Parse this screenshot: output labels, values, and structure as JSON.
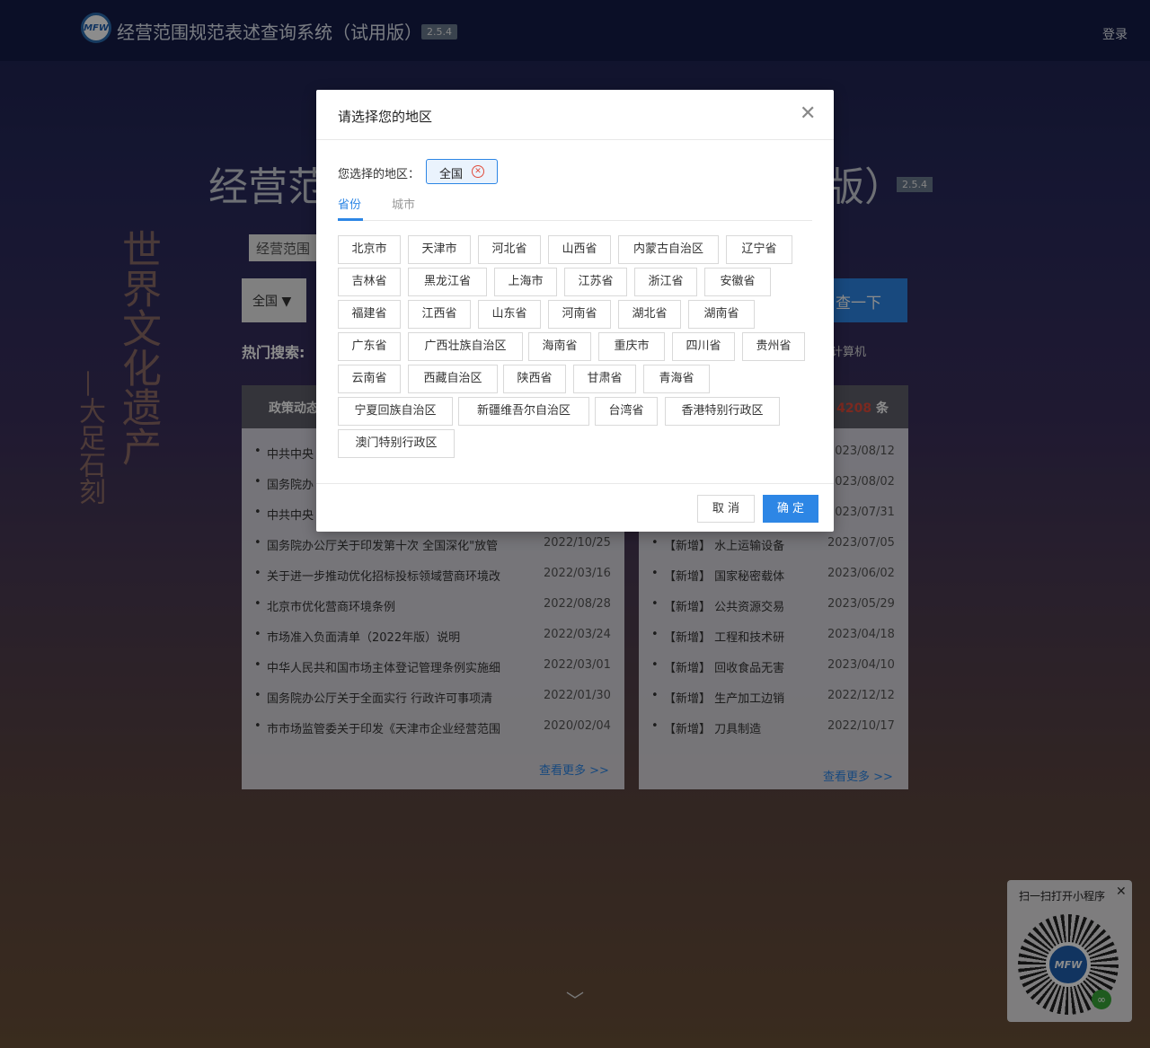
{
  "header": {
    "logo_text": "MFW",
    "app_title": "经营范围规范表述查询系统（试用版）",
    "version": "2.5.4",
    "login": "登录"
  },
  "hero": {
    "title_head": "经营范",
    "title_tail": "版）",
    "version": "2.5.4",
    "culture_main": "世界文化遗产",
    "culture_sub": "—大足石刻",
    "scope_tab": "经营范围",
    "region_select": "全国 ▼",
    "search_button": "查一下",
    "hot_label": "热门搜索:",
    "hot_tail": "计算机"
  },
  "policy_panel": {
    "title": "政策动态",
    "more": "查看更多 >>",
    "items": [
      {
        "title": "中共中央",
        "date": ""
      },
      {
        "title": "国务院办",
        "date": ""
      },
      {
        "title": "中共中央",
        "date": ""
      },
      {
        "title": "国务院办公厅关于印发第十次 全国深化\"放管",
        "date": "2022/10/25"
      },
      {
        "title": "关于进一步推动优化招标投标领域营商环境改",
        "date": "2022/03/16"
      },
      {
        "title": "北京市优化营商环境条例",
        "date": "2022/08/28"
      },
      {
        "title": "市场准入负面清单（2022年版）说明",
        "date": "2022/03/24"
      },
      {
        "title": "中华人民共和国市场主体登记管理条例实施细",
        "date": "2022/03/01"
      },
      {
        "title": "国务院办公厅关于全面实行 行政许可事项清",
        "date": "2022/01/30"
      },
      {
        "title": "市市场监管委关于印发《天津市企业经营范围",
        "date": "2020/02/04"
      }
    ]
  },
  "update_panel": {
    "count_prefix": "共",
    "count": "4208",
    "count_suffix": "条",
    "more": "查看更多 >>",
    "items": [
      {
        "title": "",
        "date": "2023/08/12"
      },
      {
        "title": "",
        "date": "2023/08/02"
      },
      {
        "title": "",
        "date": "2023/07/31"
      },
      {
        "title": "【新增】 水上运输设备",
        "date": "2023/07/05"
      },
      {
        "title": "【新增】 国家秘密载体",
        "date": "2023/06/02"
      },
      {
        "title": "【新增】 公共资源交易",
        "date": "2023/05/29"
      },
      {
        "title": "【新增】 工程和技术研",
        "date": "2023/04/18"
      },
      {
        "title": "【新增】 回收食品无害",
        "date": "2023/04/10"
      },
      {
        "title": "【新增】 生产加工边销",
        "date": "2022/12/12"
      },
      {
        "title": "【新增】 刀具制造",
        "date": "2022/10/17"
      }
    ]
  },
  "mini_program": {
    "title": "扫一扫打开小程序",
    "close": "✕",
    "logo_text": "MFW",
    "link_icon": "🔗"
  },
  "modal": {
    "title": "请选择您的地区",
    "close": "✕",
    "chosen_label": "您选择的地区：",
    "chosen_value": "全国",
    "tag_remove": "✕",
    "tab_province": "省份",
    "tab_city": "城市",
    "active_tab": "省份",
    "provinces": [
      "北京市",
      "天津市",
      "河北省",
      "山西省",
      "内蒙古自治区",
      "辽宁省",
      "吉林省",
      "黑龙江省",
      "上海市",
      "江苏省",
      "浙江省",
      "安徽省",
      "福建省",
      "江西省",
      "山东省",
      "河南省",
      "湖北省",
      "湖南省",
      "广东省",
      "广西壮族自治区",
      "海南省",
      "重庆市",
      "四川省",
      "贵州省",
      "云南省",
      "西藏自治区",
      "陕西省",
      "甘肃省",
      "青海省",
      "宁夏回族自治区",
      "新疆维吾尔自治区",
      "台湾省",
      "香港特别行政区",
      "澳门特别行政区"
    ],
    "cancel": "取 消",
    "confirm": "确 定"
  },
  "colors": {
    "accent": "#2d86e5",
    "count_red": "#e04b3b"
  }
}
